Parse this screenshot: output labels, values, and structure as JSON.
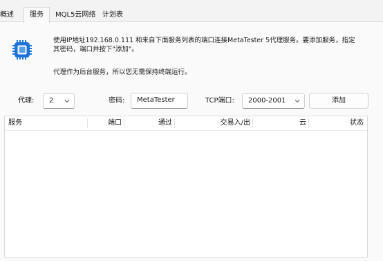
{
  "tabs": [
    {
      "label": "概述"
    },
    {
      "label": "服务"
    },
    {
      "label": "MQL5云网络"
    },
    {
      "label": "计划表"
    }
  ],
  "description": {
    "line1": "使用IP地址192.168.0.111 和来自下面服务列表的端口连接MetaTester 5代理服务。要添加服务，指定",
    "line2": "其密码，端口并按下\"添加\"。",
    "line3": "代理作为后台服务，所以您无需保持终端运行。"
  },
  "form": {
    "agents_label": "代理:",
    "agents_value": "2",
    "password_label": "密码:",
    "password_value": "MetaTester",
    "tcp_label": "TCP端口:",
    "tcp_value": "2000-2001",
    "add_button": "添加"
  },
  "table": {
    "columns": [
      "服务",
      "端口",
      "通过",
      "交易入/出",
      "云",
      "状态"
    ],
    "rows": []
  },
  "colors": {
    "chip_blue": "#1e73d8",
    "background": "#f3f3f3",
    "panel": "#fafafa"
  },
  "icons": {
    "chip": "cpu-chip-icon",
    "dropdown": "chevron-down-icon"
  }
}
